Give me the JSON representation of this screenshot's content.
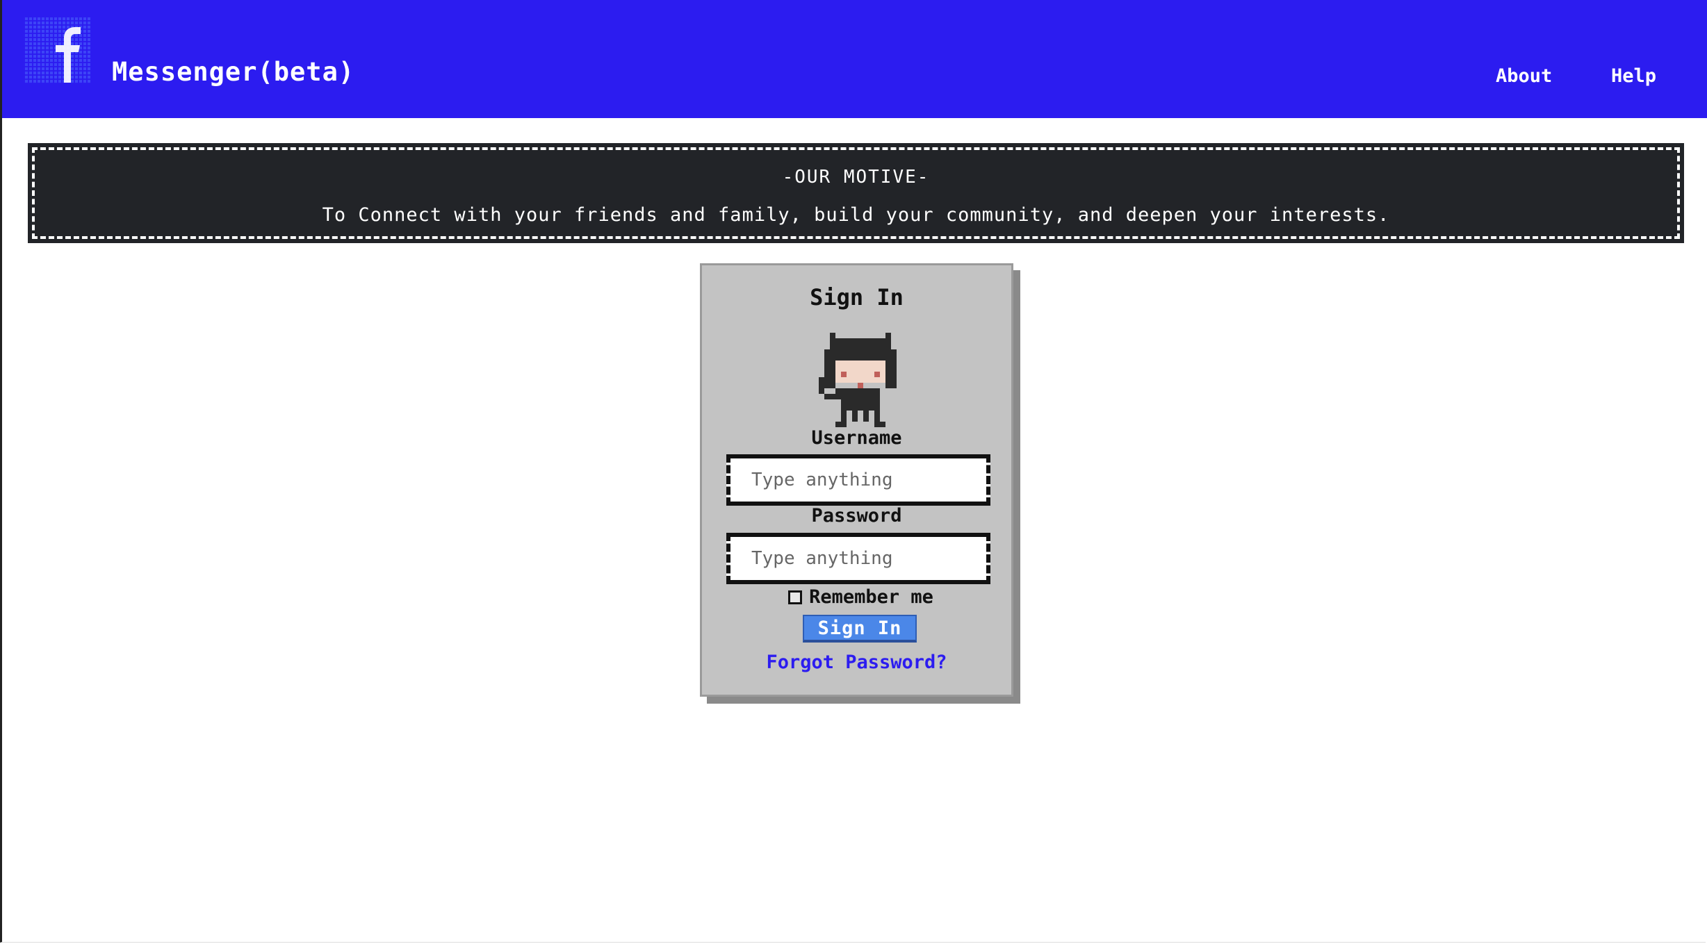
{
  "header": {
    "logo_icon": "facebook-f-icon",
    "title": "Messenger(beta)",
    "nav": {
      "about": "About",
      "help": "Help"
    },
    "background_color": "#2c1cf0"
  },
  "motive": {
    "title": "-OUR MOTIVE-",
    "text": "To Connect with your friends and family, build your community, and deepen your interests."
  },
  "signin": {
    "title": "Sign In",
    "avatar_icon": "pixel-cat-girl-avatar",
    "username_label": "Username",
    "username_placeholder": "Type anything",
    "username_value": "",
    "password_label": "Password",
    "password_placeholder": "Type anything",
    "password_value": "",
    "remember_label": "Remember me",
    "remember_checked": false,
    "button_label": "Sign In",
    "forgot_label": "Forgot Password?",
    "button_color": "#4b87e8",
    "link_color": "#2c1cf0"
  }
}
